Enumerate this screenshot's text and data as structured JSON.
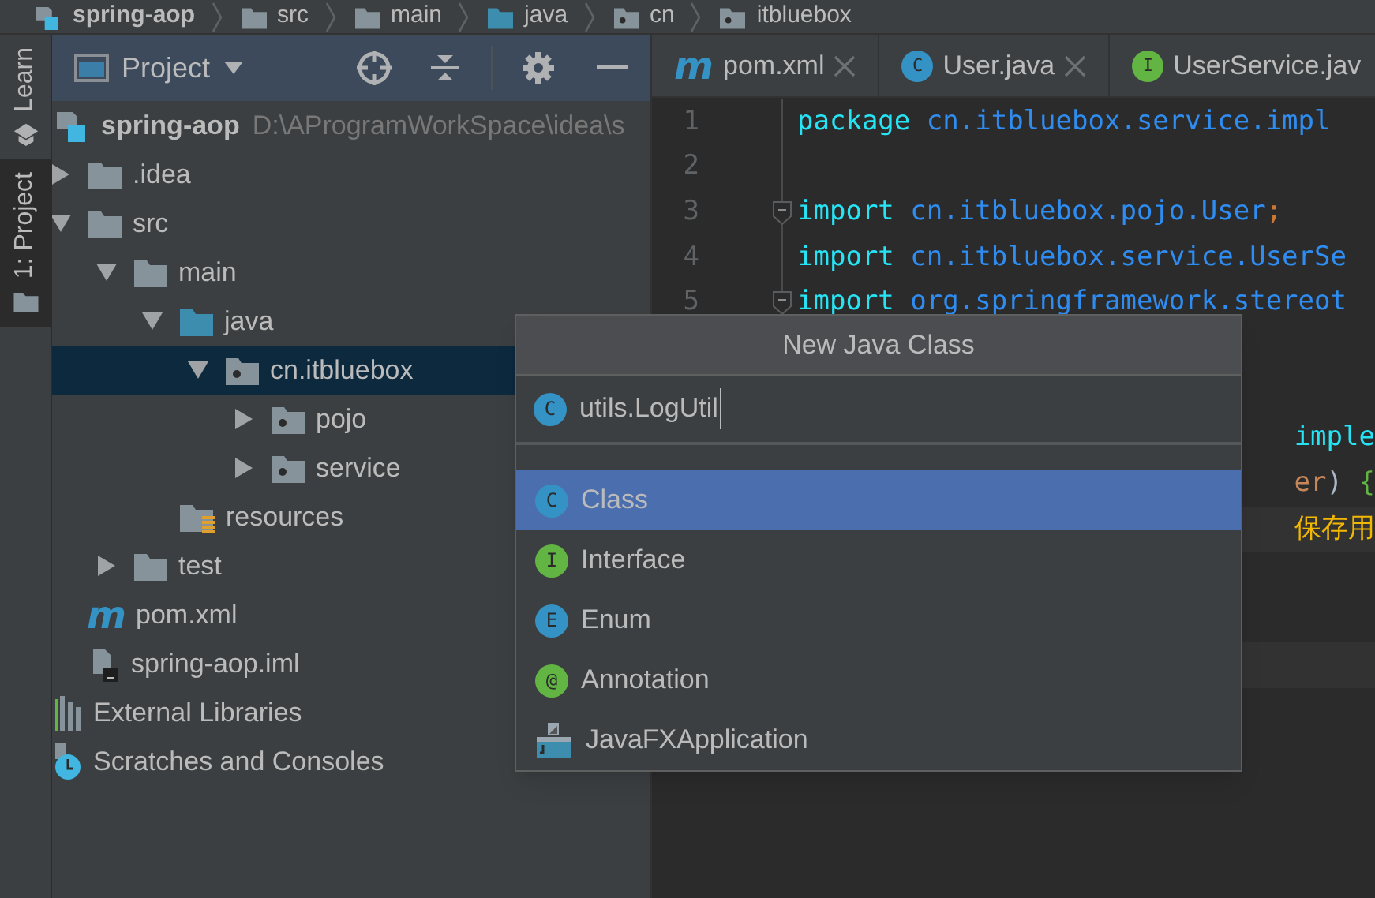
{
  "breadcrumb": [
    {
      "label": "spring-aop",
      "kind": "module"
    },
    {
      "label": "src",
      "kind": "folder"
    },
    {
      "label": "main",
      "kind": "folder"
    },
    {
      "label": "java",
      "kind": "source"
    },
    {
      "label": "cn",
      "kind": "package"
    },
    {
      "label": "itbluebox",
      "kind": "package"
    }
  ],
  "tool_stripe": [
    {
      "label": "Learn",
      "kind": "learn",
      "selected": false
    },
    {
      "label": "1: Project",
      "kind": "folder",
      "selected": true
    }
  ],
  "project_panel": {
    "title": "Project",
    "tree": [
      {
        "name": "spring-aop",
        "path": "D:\\AProgramWorkSpace\\idea\\s",
        "kind": "module",
        "selected": false,
        "children": [
          {
            "name": ".idea",
            "kind": "folder",
            "expanded": false,
            "selected": false
          },
          {
            "name": "src",
            "kind": "folder",
            "expanded": true,
            "selected": false,
            "children": [
              {
                "name": "main",
                "kind": "folder",
                "expanded": true,
                "selected": false,
                "children": [
                  {
                    "name": "java",
                    "kind": "source",
                    "expanded": true,
                    "selected": false,
                    "children": [
                      {
                        "name": "cn.itbluebox",
                        "kind": "package",
                        "expanded": true,
                        "selected": true,
                        "children": [
                          {
                            "name": "pojo",
                            "kind": "package",
                            "expanded": false,
                            "selected": false
                          },
                          {
                            "name": "service",
                            "kind": "package",
                            "expanded": false,
                            "selected": false
                          }
                        ]
                      }
                    ]
                  },
                  {
                    "name": "resources",
                    "kind": "resources",
                    "selected": false
                  }
                ]
              },
              {
                "name": "test",
                "kind": "folder",
                "expanded": false,
                "selected": false
              }
            ]
          },
          {
            "name": "pom.xml",
            "kind": "maven",
            "badge": "m",
            "selected": false
          },
          {
            "name": "spring-aop.iml",
            "kind": "iml",
            "selected": false
          }
        ]
      },
      {
        "name": "External Libraries",
        "kind": "libraries",
        "selected": false
      },
      {
        "name": "Scratches and Consoles",
        "kind": "scratches",
        "selected": false
      }
    ]
  },
  "editor_tabs": [
    {
      "label": "pom.xml",
      "kind": "maven",
      "badge": "m",
      "closable": true
    },
    {
      "label": "User.java",
      "kind": "class",
      "badge": "C",
      "closable": true
    },
    {
      "label": "UserService.jav",
      "kind": "interface",
      "badge": "I",
      "closable": false
    }
  ],
  "editor_rows": [
    {
      "number": "1",
      "tokens": [
        {
          "text": "package ",
          "kind": "keyword"
        },
        {
          "text": "cn.itbluebox.service.impl",
          "kind": "ident"
        }
      ]
    },
    {
      "number": "2",
      "tokens": []
    },
    {
      "number": "3",
      "fold": true,
      "tokens": [
        {
          "text": "import ",
          "kind": "keyword"
        },
        {
          "text": "cn.itbluebox.pojo.User",
          "kind": "ident"
        },
        {
          "text": ";",
          "kind": "punct"
        }
      ]
    },
    {
      "number": "4",
      "tokens": [
        {
          "text": "import ",
          "kind": "keyword"
        },
        {
          "text": "cn.itbluebox.service.UserSe",
          "kind": "ident"
        }
      ]
    },
    {
      "number": "5",
      "fold": true,
      "tokens": [
        {
          "text": "import ",
          "kind": "keyword"
        },
        {
          "text": "org.springframework.stereot",
          "kind": "ident"
        }
      ]
    },
    {
      "tokens": []
    },
    {
      "tokens": []
    },
    {
      "fragment": true,
      "tokens": [
        {
          "text": "imple",
          "kind": "keyword"
        }
      ]
    },
    {
      "fragment": true,
      "tokens": [
        {
          "text": "er",
          "kind": "param"
        },
        {
          "text": ") ",
          "kind": "plain"
        },
        {
          "text": "{",
          "kind": "brace"
        }
      ]
    },
    {
      "fragment": true,
      "highlighted": true,
      "tokens": [
        {
          "text": "保存用",
          "kind": "string"
        }
      ]
    },
    {
      "tokens": []
    },
    {
      "tokens": []
    },
    {
      "highlighted": true,
      "tokens": []
    }
  ],
  "dialog": {
    "title": "New Java Class",
    "badge": "C",
    "value": "utils.LogUtil",
    "items": [
      {
        "label": "Class",
        "kind": "class",
        "badge": "C",
        "selected": true
      },
      {
        "label": "Interface",
        "kind": "interface",
        "badge": "I",
        "selected": false
      },
      {
        "label": "Enum",
        "kind": "enum",
        "badge": "E",
        "selected": false
      },
      {
        "label": "Annotation",
        "kind": "annotation",
        "badge": "@",
        "selected": false
      },
      {
        "label": "JavaFXApplication",
        "kind": "javafx",
        "selected": false
      }
    ]
  }
}
